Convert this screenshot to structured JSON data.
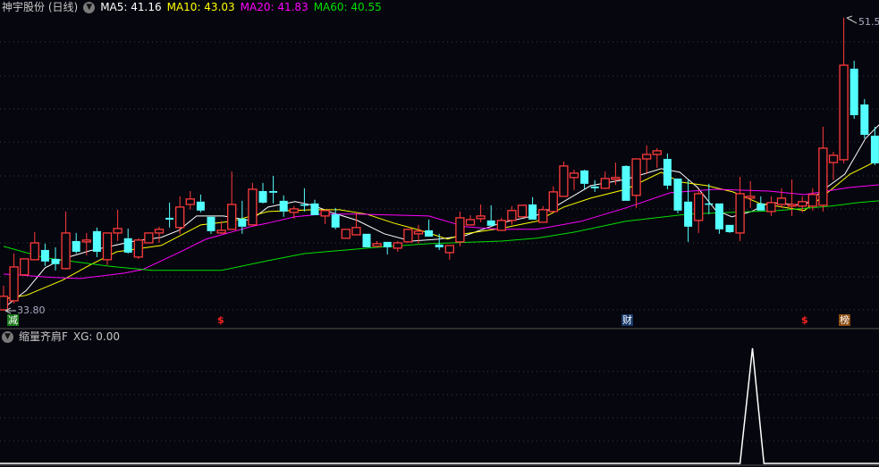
{
  "header": {
    "title": "神宇股份 (日线)",
    "ma5_label": "MA5: 41.16",
    "ma10_label": "MA10: 43.03",
    "ma20_label": "MA20: 41.83",
    "ma60_label": "MA60: 40.55",
    "dropdown_icon": "chevron-down-icon"
  },
  "indicator": {
    "title": "缩量齐肩F",
    "xg_label": "XG: 0.00"
  },
  "markers": {
    "reduce": "减",
    "finance": "财",
    "board": "榜",
    "dollar1": "$",
    "dollar2": "$"
  },
  "price_labels": {
    "low": "33.80",
    "high": "51.5"
  },
  "colors": {
    "up": "#ff3b3b",
    "down": "#54ffff",
    "doji": "#c0c0c0",
    "ma5": "#ffffff",
    "ma10": "#ffff00",
    "ma20": "#ff00ff",
    "ma60": "#00e000",
    "background": "#06060e"
  },
  "chart_data": [
    {
      "type": "candlestick",
      "title": "神宇股份 (日线)",
      "ylim": [
        33.8,
        51.5
      ],
      "grid": true,
      "ohlc": [
        [
          33.8,
          35.27,
          33.8,
          34.62
        ],
        [
          34.35,
          37.21,
          34.19,
          36.4
        ],
        [
          35.92,
          36.89,
          35.92,
          36.89
        ],
        [
          36.84,
          38.51,
          36.84,
          37.86
        ],
        [
          37.43,
          37.81,
          36.46,
          36.73
        ],
        [
          36.89,
          37.59,
          36.19,
          36.57
        ],
        [
          36.3,
          39.76,
          36.24,
          38.46
        ],
        [
          37.97,
          38.46,
          37.21,
          37.32
        ],
        [
          37.92,
          38.46,
          37.1,
          38.03
        ],
        [
          38.57,
          38.79,
          37.0,
          37.32
        ],
        [
          36.84,
          38.46,
          36.51,
          38.46
        ],
        [
          38.46,
          39.87,
          37.97,
          38.73
        ],
        [
          38.14,
          38.73,
          37.21,
          37.27
        ],
        [
          37.0,
          38.14,
          36.89,
          38.03
        ],
        [
          37.86,
          38.46,
          37.86,
          38.46
        ],
        [
          38.46,
          38.84,
          37.86,
          38.68
        ],
        [
          39.38,
          40.3,
          38.79,
          39.27
        ],
        [
          38.79,
          40.68,
          38.41,
          40.03
        ],
        [
          40.19,
          41.0,
          39.87,
          40.52
        ],
        [
          40.36,
          40.79,
          39.71,
          39.82
        ],
        [
          39.44,
          39.44,
          38.41,
          38.57
        ],
        [
          38.46,
          39.17,
          38.41,
          38.62
        ],
        [
          38.68,
          42.19,
          38.68,
          40.19
        ],
        [
          39.33,
          40.41,
          38.41,
          38.84
        ],
        [
          38.95,
          41.49,
          38.95,
          41.11
        ],
        [
          41.0,
          41.49,
          40.25,
          40.3
        ],
        [
          41.0,
          41.92,
          40.25,
          40.9
        ],
        [
          40.41,
          40.74,
          39.44,
          39.76
        ],
        [
          39.71,
          40.09,
          39.33,
          39.92
        ],
        [
          40.19,
          41.17,
          39.76,
          40.14
        ],
        [
          40.25,
          40.47,
          39.54,
          39.54
        ],
        [
          39.49,
          39.82,
          39.0,
          39.82
        ],
        [
          39.6,
          39.98,
          38.68,
          38.79
        ],
        [
          38.14,
          38.68,
          38.14,
          38.68
        ],
        [
          38.35,
          39.71,
          38.35,
          38.79
        ],
        [
          38.41,
          38.41,
          37.59,
          37.59
        ],
        [
          37.65,
          37.97,
          37.59,
          37.81
        ],
        [
          37.92,
          37.92,
          37.16,
          37.59
        ],
        [
          37.54,
          37.97,
          37.32,
          37.86
        ],
        [
          37.92,
          38.68,
          37.92,
          38.68
        ],
        [
          38.41,
          38.95,
          37.81,
          38.57
        ],
        [
          38.62,
          39.27,
          38.24,
          38.24
        ],
        [
          37.76,
          38.41,
          37.43,
          37.59
        ],
        [
          37.27,
          37.7,
          36.84,
          37.7
        ],
        [
          37.92,
          39.76,
          37.65,
          39.38
        ],
        [
          38.95,
          39.54,
          38.95,
          39.27
        ],
        [
          39.33,
          40.19,
          39.11,
          39.49
        ],
        [
          39.22,
          40.14,
          38.9,
          38.9
        ],
        [
          38.62,
          39.38,
          38.62,
          39.22
        ],
        [
          39.22,
          40.09,
          38.95,
          39.82
        ],
        [
          39.44,
          40.14,
          39.44,
          40.14
        ],
        [
          40.19,
          40.63,
          39.27,
          39.27
        ],
        [
          39.11,
          40.09,
          39.11,
          39.87
        ],
        [
          39.76,
          41.28,
          39.76,
          40.95
        ],
        [
          40.68,
          42.79,
          40.68,
          42.52
        ],
        [
          41.82,
          42.3,
          41.06,
          42.09
        ],
        [
          42.25,
          42.3,
          41.11,
          41.44
        ],
        [
          41.28,
          41.66,
          40.95,
          41.17
        ],
        [
          41.17,
          42.19,
          41.17,
          41.76
        ],
        [
          41.71,
          42.73,
          41.38,
          41.82
        ],
        [
          42.52,
          42.57,
          40.41,
          40.41
        ],
        [
          40.74,
          42.95,
          39.98,
          42.95
        ],
        [
          42.95,
          43.76,
          42.03,
          43.22
        ],
        [
          43.22,
          43.6,
          42.41,
          43.44
        ],
        [
          42.95,
          43.28,
          41.11,
          41.33
        ],
        [
          41.76,
          41.76,
          39.65,
          39.82
        ],
        [
          40.36,
          41.66,
          37.92,
          38.84
        ],
        [
          39.22,
          41.06,
          38.46,
          40.84
        ],
        [
          40.25,
          41.44,
          39.6,
          40.25
        ],
        [
          40.25,
          40.25,
          38.41,
          38.68
        ],
        [
          38.95,
          38.95,
          38.46,
          38.51
        ],
        [
          38.46,
          41.87,
          37.97,
          40.84
        ],
        [
          40.57,
          41.6,
          39.98,
          40.68
        ],
        [
          40.25,
          40.68,
          39.82,
          39.82
        ],
        [
          39.76,
          40.68,
          39.49,
          40.3
        ],
        [
          40.19,
          41.17,
          39.98,
          40.57
        ],
        [
          40.09,
          41.71,
          39.49,
          40.19
        ],
        [
          40.09,
          40.68,
          39.71,
          40.36
        ],
        [
          40.09,
          41.17,
          39.82,
          40.79
        ],
        [
          40.14,
          44.9,
          39.76,
          43.6
        ],
        [
          42.73,
          43.38,
          41.66,
          43.17
        ],
        [
          42.9,
          51.5,
          42.68,
          48.63
        ],
        [
          48.42,
          48.9,
          45.38,
          45.6
        ],
        [
          46.25,
          46.58,
          44.19,
          44.41
        ],
        [
          44.36,
          44.9,
          42.57,
          42.68
        ]
      ],
      "series": [
        {
          "name": "MA5",
          "points": [
            [
              0,
              33.91
            ],
            [
              2.2,
              34.98
            ],
            [
              4,
              36.35
            ],
            [
              5.7,
              36.89
            ],
            [
              8.3,
              37.38
            ],
            [
              12.6,
              37.97
            ],
            [
              15.2,
              38.19
            ],
            [
              16.9,
              38.62
            ],
            [
              18.6,
              39.49
            ],
            [
              21.2,
              39.49
            ],
            [
              23.8,
              39.22
            ],
            [
              25.5,
              40.03
            ],
            [
              28.1,
              40.36
            ],
            [
              29.8,
              40.14
            ],
            [
              31.6,
              39.71
            ],
            [
              34.1,
              39.22
            ],
            [
              36.7,
              38.41
            ],
            [
              39.3,
              37.97
            ],
            [
              41.9,
              38.08
            ],
            [
              44.5,
              38.3
            ],
            [
              47.9,
              39.06
            ],
            [
              51.4,
              39.54
            ],
            [
              53.1,
              40.03
            ],
            [
              56.6,
              41.33
            ],
            [
              60,
              41.71
            ],
            [
              63.4,
              42.36
            ],
            [
              65.2,
              42.14
            ],
            [
              66.9,
              41.22
            ],
            [
              68.6,
              39.87
            ],
            [
              70.2,
              39.44
            ],
            [
              72.1,
              39.76
            ],
            [
              73.8,
              40.3
            ],
            [
              77.2,
              40.14
            ],
            [
              79,
              41.06
            ],
            [
              81.1,
              42.03
            ],
            [
              83.1,
              44.2
            ],
            [
              84.4,
              45.01
            ]
          ]
        },
        {
          "name": "MA10",
          "points": [
            [
              0,
              34.46
            ],
            [
              2.2,
              34.68
            ],
            [
              5.7,
              35.6
            ],
            [
              8.3,
              36.51
            ],
            [
              10.9,
              37.32
            ],
            [
              15.2,
              37.7
            ],
            [
              19,
              38.95
            ],
            [
              22,
              39.17
            ],
            [
              25.5,
              39.76
            ],
            [
              29.8,
              39.87
            ],
            [
              32.4,
              39.87
            ],
            [
              35,
              39.6
            ],
            [
              37.6,
              39.06
            ],
            [
              40.2,
              38.62
            ],
            [
              42.8,
              38.08
            ],
            [
              44.5,
              38.41
            ],
            [
              47.9,
              38.73
            ],
            [
              51.4,
              39.17
            ],
            [
              54,
              40.03
            ],
            [
              56.6,
              40.57
            ],
            [
              60,
              41.11
            ],
            [
              63.4,
              42.14
            ],
            [
              65.2,
              41.55
            ],
            [
              67.8,
              41.33
            ],
            [
              70.3,
              40.95
            ],
            [
              72.9,
              40.25
            ],
            [
              77.2,
              39.82
            ],
            [
              79,
              40.68
            ],
            [
              81.6,
              42.03
            ],
            [
              84.4,
              42.9
            ]
          ]
        },
        {
          "name": "MA20",
          "points": [
            [
              0,
              35.97
            ],
            [
              4.8,
              35.76
            ],
            [
              7.4,
              35.7
            ],
            [
              11.7,
              36.03
            ],
            [
              13.4,
              36.24
            ],
            [
              16.9,
              37.27
            ],
            [
              19.5,
              38.08
            ],
            [
              23.8,
              38.84
            ],
            [
              25.5,
              39.06
            ],
            [
              28.1,
              39.44
            ],
            [
              30.7,
              39.6
            ],
            [
              34.1,
              39.6
            ],
            [
              41,
              39.49
            ],
            [
              44.5,
              38.84
            ],
            [
              47.9,
              38.68
            ],
            [
              51.4,
              38.68
            ],
            [
              55.7,
              39.17
            ],
            [
              60,
              39.98
            ],
            [
              64.3,
              40.9
            ],
            [
              68.6,
              41.11
            ],
            [
              73.8,
              41.0
            ],
            [
              77.2,
              40.79
            ],
            [
              81.6,
              41.22
            ],
            [
              84.4,
              41.38
            ]
          ]
        },
        {
          "name": "MA60",
          "points": [
            [
              0,
              37.65
            ],
            [
              4,
              36.95
            ],
            [
              10,
              36.46
            ],
            [
              14.3,
              36.19
            ],
            [
              21,
              36.19
            ],
            [
              25.5,
              36.78
            ],
            [
              29,
              37.21
            ],
            [
              36,
              37.59
            ],
            [
              41,
              37.81
            ],
            [
              48,
              37.97
            ],
            [
              51.4,
              38.14
            ],
            [
              55,
              38.51
            ],
            [
              60,
              39.17
            ],
            [
              66,
              39.6
            ],
            [
              70.3,
              39.71
            ],
            [
              74.7,
              39.82
            ],
            [
              79.8,
              40.09
            ],
            [
              82.4,
              40.3
            ],
            [
              84.4,
              40.41
            ]
          ]
        }
      ]
    },
    {
      "type": "line",
      "title": "缩量齐肩F",
      "ylim": [
        0,
        1
      ],
      "series": [
        {
          "name": "XG",
          "points": [
            [
              0,
              0
            ],
            [
              71,
              0
            ],
            [
              72.2,
              1
            ],
            [
              73.3,
              0
            ],
            [
              84.4,
              0
            ]
          ]
        }
      ]
    }
  ]
}
